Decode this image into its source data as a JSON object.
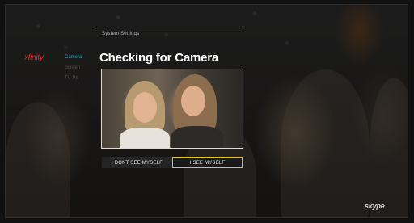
{
  "section": {
    "title": "System Settings"
  },
  "brand": {
    "name": "xfinity"
  },
  "side_menu": {
    "items": [
      {
        "label": "Camera",
        "active": true
      },
      {
        "label": "Screen",
        "active": false
      },
      {
        "label": "TV Pa",
        "active": false
      }
    ]
  },
  "dialog": {
    "title": "Checking for Camera",
    "buttons": {
      "no": "I DONT SEE MYSELF",
      "yes": "I SEE MYSELF"
    }
  },
  "footer": {
    "logo_text": "skype"
  },
  "colors": {
    "brand_red": "#e2262a",
    "active_blue": "#2fa3c6",
    "focus_yellow": "#e6c22c"
  }
}
